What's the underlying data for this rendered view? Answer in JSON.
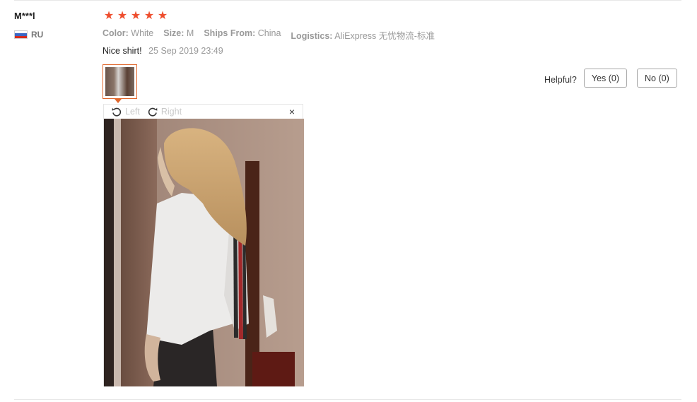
{
  "review": {
    "user_name": "M***l",
    "country_code": "RU",
    "rating": 5,
    "rating_stars": [
      "★",
      "★",
      "★",
      "★",
      "★"
    ],
    "attributes": [
      {
        "label": "Color:",
        "value": "White"
      },
      {
        "label": "Size:",
        "value": "M"
      },
      {
        "label": "Ships From:",
        "value": "China"
      },
      {
        "label": "Logistics:",
        "value": "AliExpress 无忧物流-标准"
      }
    ],
    "comment": "Nice shirt!",
    "date": "25 Sep 2019 23:49"
  },
  "viewer": {
    "rotate_left_label": "Left",
    "rotate_right_label": "Right",
    "close_glyph": "×"
  },
  "helpful": {
    "label": "Helpful?",
    "yes_label": "Yes (0)",
    "no_label": "No (0)"
  },
  "colors": {
    "star": "#ee4d2d",
    "thumb_border": "#e0672c"
  },
  "icons": {
    "rotate_left": "rotate-left-icon",
    "rotate_right": "rotate-right-icon",
    "close": "close-icon",
    "flag": "russia-flag-icon",
    "star": "star-icon"
  }
}
